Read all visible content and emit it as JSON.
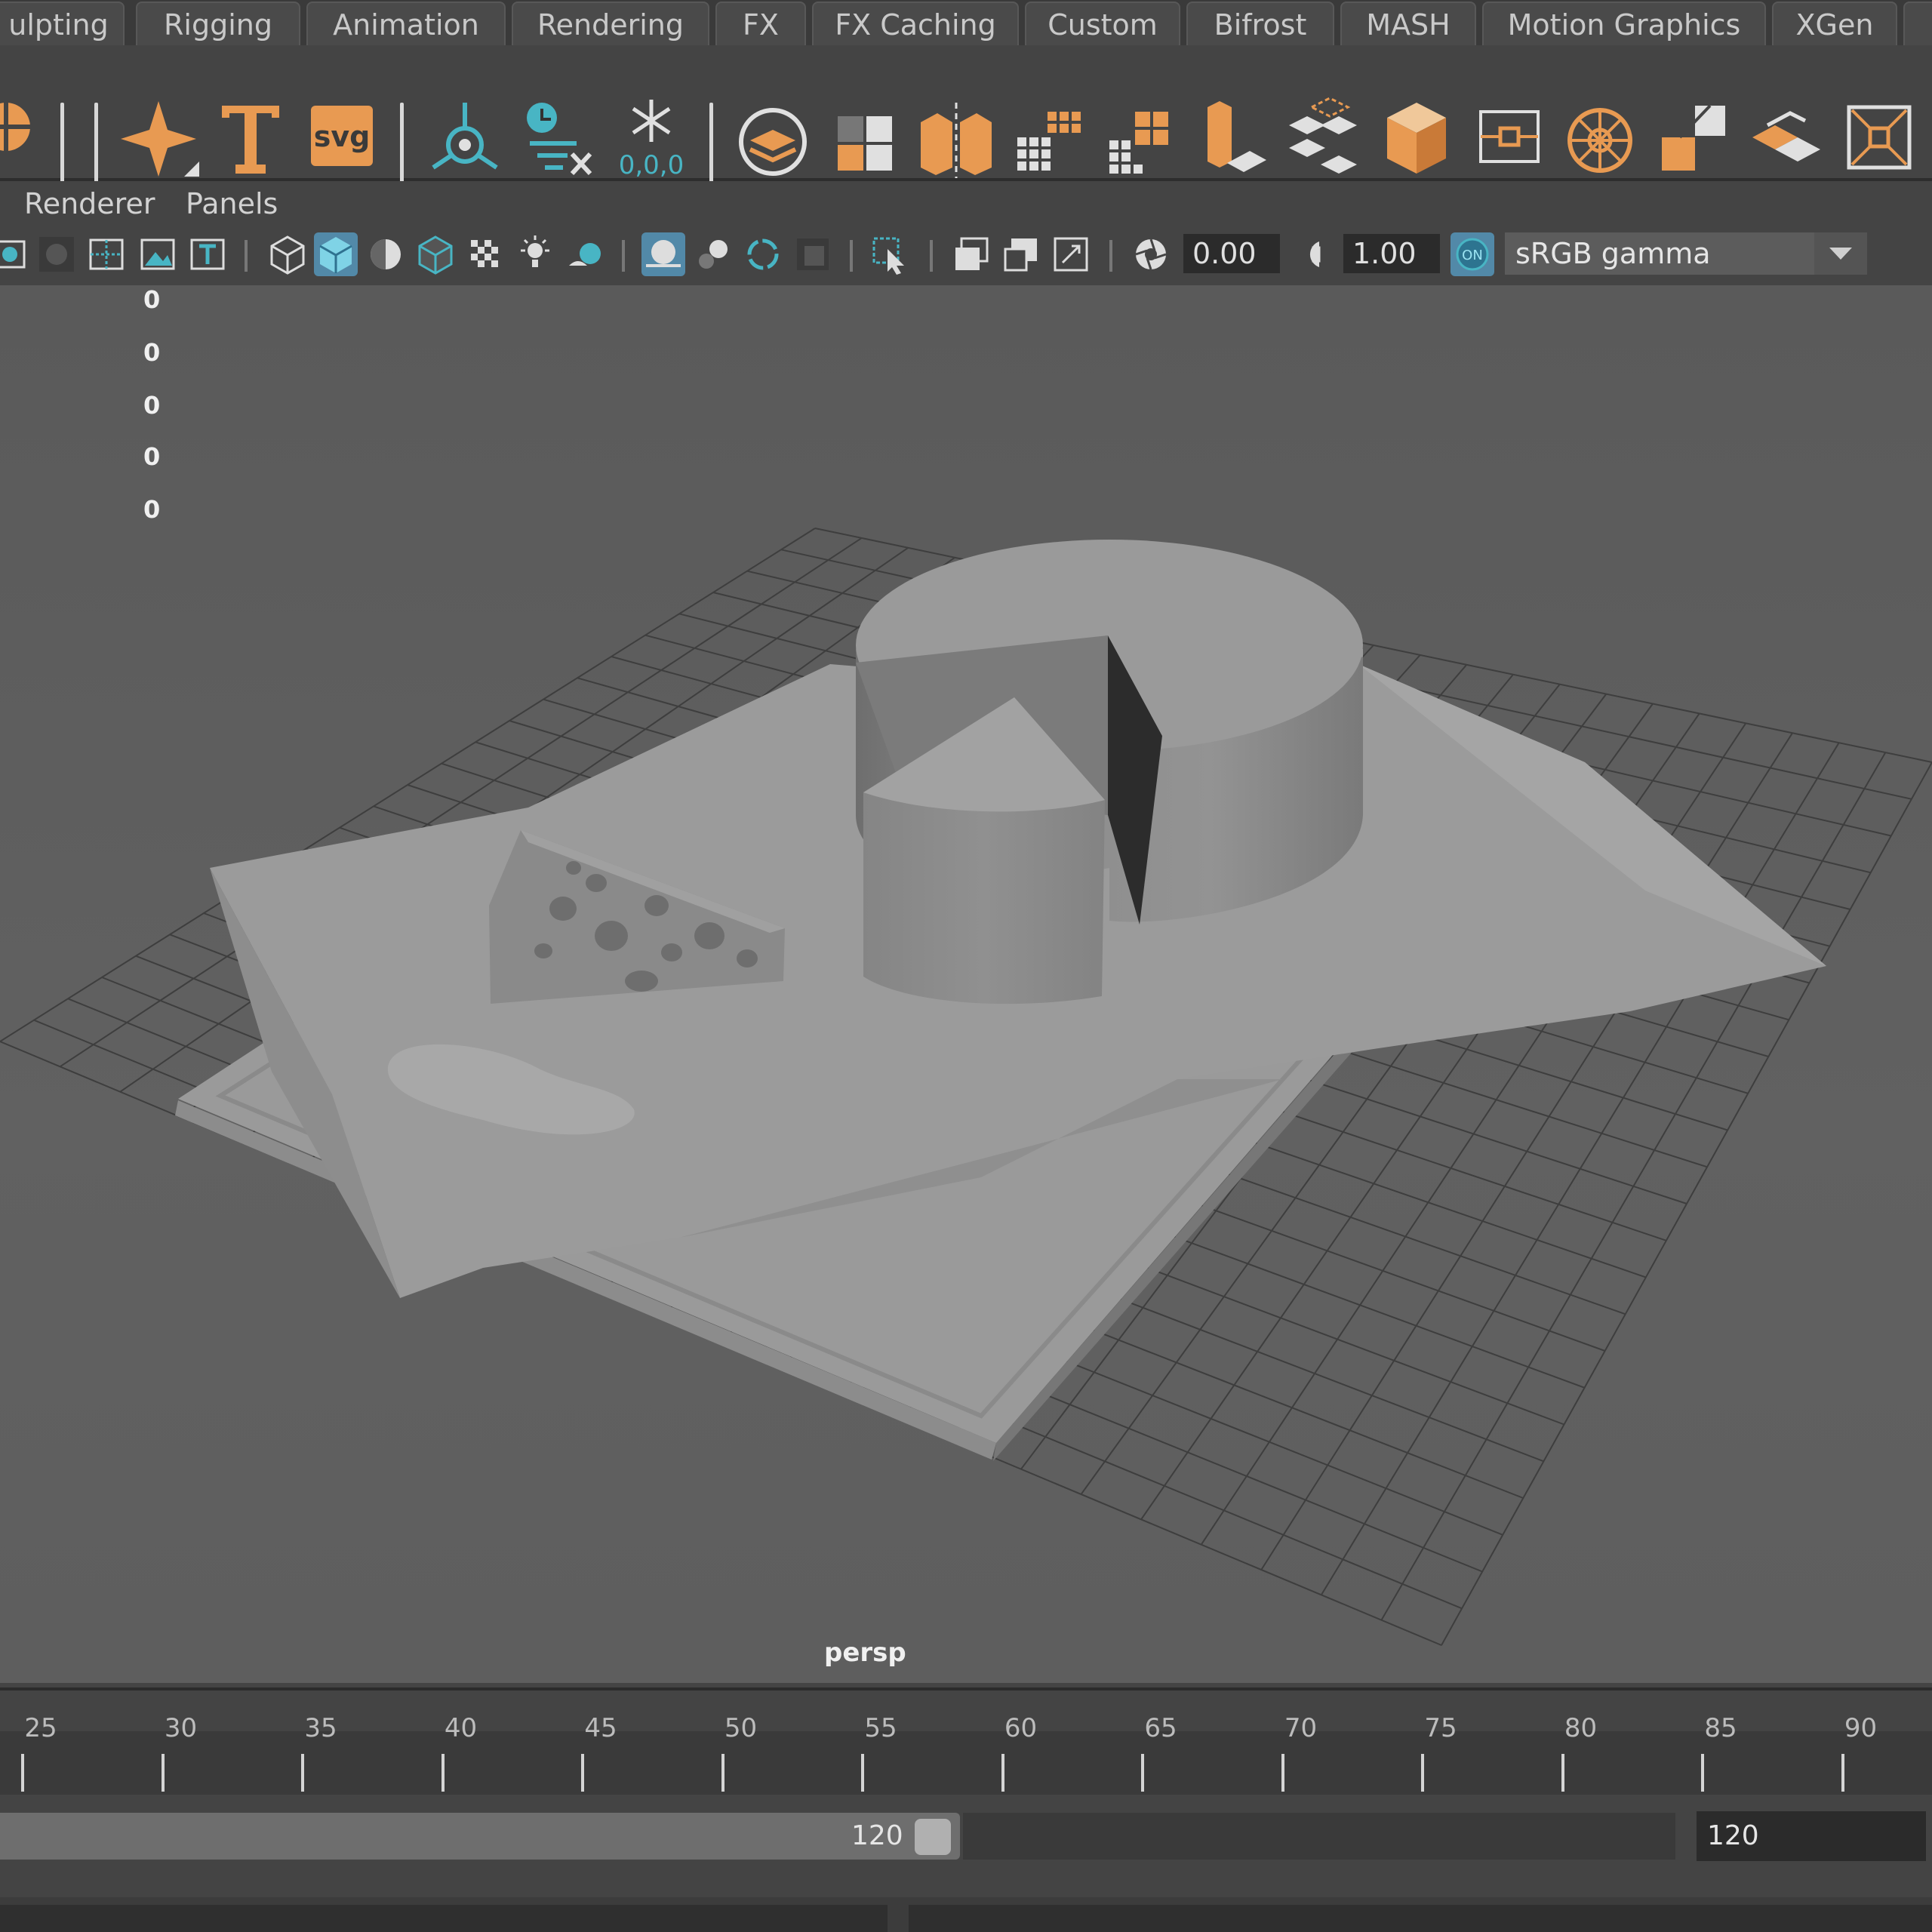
{
  "shelf_tabs": [
    "ulpting",
    "Rigging",
    "Animation",
    "Rendering",
    "FX",
    "FX Caching",
    "Custom",
    "Bifrost",
    "MASH",
    "Motion Graphics",
    "XGen"
  ],
  "shelf": {
    "svg_label": "svg",
    "coord_label": "0,0,0"
  },
  "panel_menu": {
    "renderer": "Renderer",
    "panels": "Panels"
  },
  "panel_toolbar": {
    "exposure": "0.00",
    "gamma_value": "1.00",
    "color_transform": "sRGB gamma",
    "on_label": "ON"
  },
  "viewport": {
    "hud_values": [
      "0",
      "0",
      "0",
      "0",
      "0"
    ],
    "camera_label": "persp"
  },
  "timeline": {
    "tick_labels": [
      "25",
      "30",
      "35",
      "40",
      "45",
      "50",
      "55",
      "60",
      "65",
      "70",
      "75",
      "80",
      "85",
      "90"
    ]
  },
  "range": {
    "current": "120",
    "end": "120"
  },
  "colors": {
    "accent_orange": "#e89a52",
    "accent_teal": "#48b5c4",
    "active_button": "#5289a8"
  }
}
